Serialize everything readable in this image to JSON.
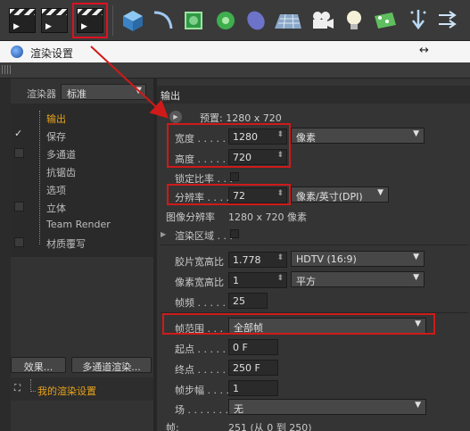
{
  "toolbar": {
    "icons": [
      "render-view-icon",
      "render-to-picture-viewer-icon",
      "render-settings-icon",
      "cube-icon",
      "spline-icon",
      "generator-icon",
      "deformer-icon",
      "nurbs-icon",
      "floor-icon",
      "camera-icon",
      "light-icon",
      "tag-icon",
      "field-icon",
      "deformer-arrows-icon"
    ]
  },
  "window": {
    "title": "渲染设置"
  },
  "left": {
    "renderer_label": "渲染器",
    "renderer_value": "标准",
    "items": [
      {
        "label": "输出",
        "active": true,
        "check": "none"
      },
      {
        "label": "保存",
        "active": false,
        "check": "tick"
      },
      {
        "label": "多通道",
        "active": false,
        "check": "box"
      },
      {
        "label": "抗锯齿",
        "active": false,
        "check": "none"
      },
      {
        "label": "选项",
        "active": false,
        "check": "none"
      },
      {
        "label": "立体",
        "active": false,
        "check": "box"
      },
      {
        "label": "Team Render",
        "active": false,
        "check": "none"
      },
      {
        "label": "材质覆写",
        "active": false,
        "check": "box"
      }
    ],
    "effects_button": "效果...",
    "multipass_button": "多通道渲染...",
    "my_setting": "我的渲染设置"
  },
  "output": {
    "header": "输出",
    "preset": "预置: 1280 x 720",
    "width_label": "宽度",
    "width_value": "1280",
    "height_label": "高度",
    "height_value": "720",
    "unit_value": "像素",
    "lock_ratio_label": "锁定比率",
    "resolution_label": "分辨率",
    "resolution_value": "72",
    "resolution_unit": "像素/英寸(DPI)",
    "image_resolution_label": "图像分辨率",
    "image_resolution_value": "1280 x 720 像素",
    "render_region_label": "渲染区域",
    "film_aspect_label": "胶片宽高比",
    "film_aspect_value": "1.778",
    "film_aspect_preset": "HDTV (16:9)",
    "pixel_aspect_label": "像素宽高比",
    "pixel_aspect_value": "1",
    "pixel_aspect_preset": "平方",
    "fps_label": "帧频",
    "fps_value": "25",
    "frame_range_label": "帧范围",
    "frame_range_value": "全部帧",
    "start_label": "起点",
    "start_value": "0 F",
    "end_label": "终点",
    "end_value": "250 F",
    "step_label": "帧步幅",
    "step_value": "1",
    "field_label": "场",
    "field_value": "无",
    "frames_label": "帧:",
    "frames_value": "251 (从 0 到 250)"
  }
}
